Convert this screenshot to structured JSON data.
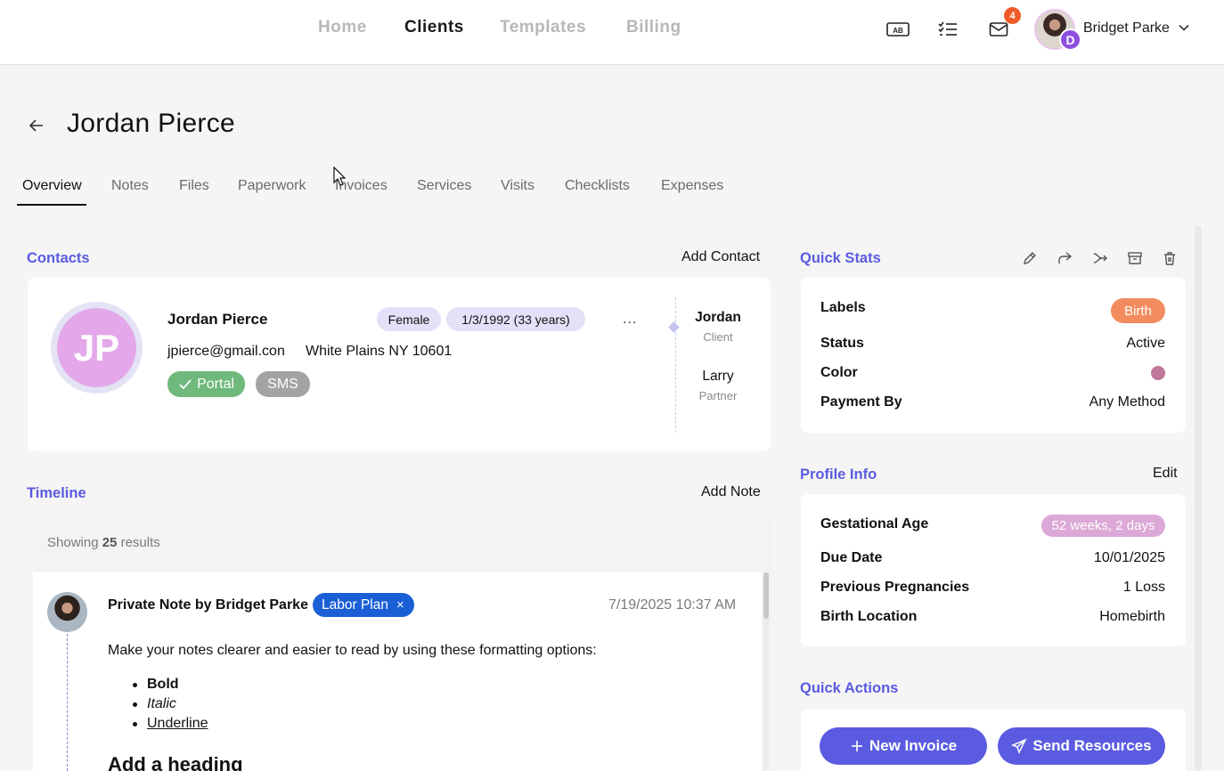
{
  "nav": {
    "links": [
      "Home",
      "Clients",
      "Templates",
      "Billing"
    ],
    "notification_count": "4",
    "user_name": "Bridget Parke",
    "user_initial": "D",
    "icons": [
      "translate-ab-icon",
      "checklist-icon",
      "mail-icon",
      "chevron-down-icon"
    ]
  },
  "page": {
    "title": "Jordan Pierce"
  },
  "tabs": [
    "Overview",
    "Notes",
    "Files",
    "Paperwork",
    "Invoices",
    "Services",
    "Visits",
    "Checklists",
    "Expenses"
  ],
  "contacts": {
    "heading": "Contacts",
    "add_label": "Add Contact",
    "initials": "JP",
    "name": "Jordan Pierce",
    "gender": "Female",
    "dob": "1/3/1992 (33 years)",
    "email": "jpierce@gmail.con",
    "location": "White Plains NY 10601",
    "portal_label": "Portal",
    "sms_label": "SMS",
    "more_label": "...",
    "people": [
      {
        "name": "Jordan",
        "role": "Client"
      },
      {
        "name": "Larry",
        "role": "Partner"
      }
    ]
  },
  "timeline": {
    "heading": "Timeline",
    "add_label": "Add Note",
    "showing_prefix": "Showing",
    "showing_count": "25",
    "showing_suffix": "results",
    "note": {
      "title": "Private Note by Bridget Parke",
      "tag": "Labor Plan",
      "tag_remove": "×",
      "timestamp": "7/19/2025 10:37 AM",
      "body": "Make your notes clearer and easier to read by using these formatting options:",
      "list": [
        "Bold",
        "Italic",
        "Underline"
      ],
      "heading": "Add a heading"
    }
  },
  "quick_stats": {
    "heading": "Quick Stats",
    "icons": [
      "edit-pencil-icon",
      "share-icon",
      "transfer-icon",
      "archive-icon",
      "trash-icon"
    ],
    "labels_label": "Labels",
    "labels_value": "Birth",
    "labels_color": "#f28c5e",
    "status_label": "Status",
    "status_value": "Active",
    "color_label": "Color",
    "color_value": "#c07898",
    "payment_label": "Payment By",
    "payment_value": "Any Method"
  },
  "profile_info": {
    "heading": "Profile Info",
    "edit_label": "Edit",
    "gest_label": "Gestational Age",
    "gest_value": "52 weeks, 2 days",
    "due_label": "Due Date",
    "due_value": "10/01/2025",
    "prev_label": "Previous Pregnancies",
    "prev_value": "1 Loss",
    "birth_loc_label": "Birth Location",
    "birth_loc_value": "Homebirth"
  },
  "quick_actions": {
    "heading": "Quick Actions",
    "new_invoice": "New Invoice",
    "send_resources": "Send Resources"
  },
  "colors": {
    "accent": "#5a5be0",
    "portal": "#6fb97c",
    "sms": "#a3a3a3",
    "labor_tag": "#1b5fd6"
  }
}
